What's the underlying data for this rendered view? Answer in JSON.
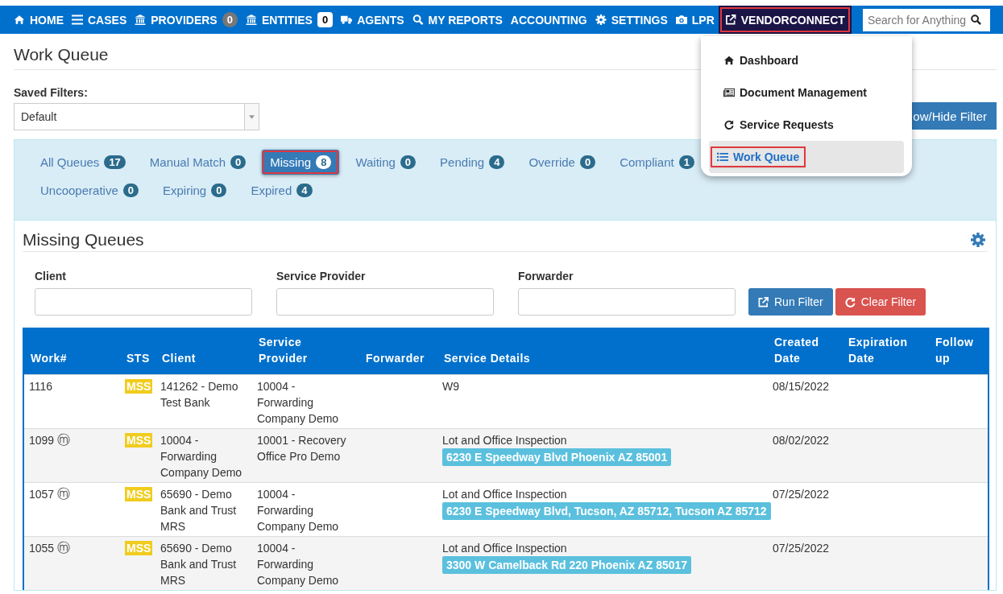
{
  "nav": {
    "items": [
      {
        "kind": "home",
        "label": "HOME"
      },
      {
        "kind": "cases",
        "label": "CASES"
      },
      {
        "kind": "providers",
        "label": "PROVIDERS",
        "count": "0"
      },
      {
        "kind": "entities",
        "label": "ENTITIES",
        "count": "0"
      },
      {
        "kind": "agents",
        "label": "AGENTS"
      },
      {
        "kind": "reports",
        "label": "MY REPORTS"
      },
      {
        "kind": "plain",
        "label": "ACCOUNTING"
      },
      {
        "kind": "settings",
        "label": "SETTINGS"
      },
      {
        "kind": "lpr",
        "label": "LPR"
      },
      {
        "kind": "vendor",
        "label": "VENDORCONNECT",
        "selected": true,
        "highlighted": true
      }
    ],
    "search": {
      "placeholder": "Search for Anything"
    }
  },
  "dropdown": [
    {
      "kind": "dashboard",
      "label": "Dashboard",
      "selected": false,
      "highlighted": false
    },
    {
      "kind": "documents",
      "label": "Document Management",
      "selected": false,
      "highlighted": false
    },
    {
      "kind": "requests",
      "label": "Service Requests",
      "selected": false,
      "highlighted": false
    },
    {
      "kind": "queue",
      "label": "Work Queue",
      "selected": true,
      "highlighted": true
    }
  ],
  "page_title": "Work Queue",
  "saved_filters": {
    "label": "Saved Filters:",
    "value": "Default"
  },
  "show_hide_button": "ow/Hide Filter",
  "tabs": [
    {
      "label": "All Queues",
      "count": "17",
      "selected": false,
      "highlighted": false
    },
    {
      "label": "Manual Match",
      "count": "0",
      "selected": false,
      "highlighted": false
    },
    {
      "label": "Missing",
      "count": "8",
      "selected": true,
      "highlighted": true
    },
    {
      "label": "Waiting",
      "count": "0",
      "selected": false,
      "highlighted": false
    },
    {
      "label": "Pending",
      "count": "4",
      "selected": false,
      "highlighted": false
    },
    {
      "label": "Override",
      "count": "0",
      "selected": false,
      "highlighted": false
    },
    {
      "label": "Compliant",
      "count": "1",
      "selected": false,
      "highlighted": false
    },
    {
      "label": "Uncooperative",
      "count": "0",
      "selected": false,
      "highlighted": false
    },
    {
      "label": "Expiring",
      "count": "0",
      "selected": false,
      "highlighted": false
    },
    {
      "label": "Expired",
      "count": "4",
      "selected": false,
      "highlighted": false
    }
  ],
  "section_title": "Missing Queues",
  "filters": [
    {
      "label": "Client"
    },
    {
      "label": "Service Provider"
    },
    {
      "label": "Forwarder"
    }
  ],
  "buttons": [
    {
      "kind": "run",
      "label": "Run Filter"
    },
    {
      "kind": "clear",
      "label": "Clear Filter"
    }
  ],
  "table": {
    "columns": [
      "Work#",
      "STS",
      "Client",
      "Service Provider",
      "Forwarder",
      "Service Details",
      "Created Date",
      "Expiration Date",
      "Follow up"
    ],
    "rows": [
      {
        "work": "1116",
        "mark": "",
        "status": "MSS",
        "client": "141262 - Demo Test Bank",
        "provider": "10004 - Forwarding Company Demo",
        "details": "W9",
        "address": "",
        "created": "08/15/2022"
      },
      {
        "work": "1099",
        "mark": "ⓜ",
        "status": "MSS",
        "client": "10004 - Forwarding Company Demo",
        "provider": "10001 - Recovery Office Pro Demo",
        "details": "Lot and Office Inspection",
        "address": "6230 E Speedway Blvd Phoenix AZ 85001",
        "created": "08/02/2022"
      },
      {
        "work": "1057",
        "mark": "ⓜ",
        "status": "MSS",
        "client": "65690 - Demo Bank and Trust MRS",
        "provider": "10004 - Forwarding Company Demo",
        "details": "Lot and Office Inspection",
        "address": "6230 E Speedway Blvd, Tucson, AZ 85712, Tucson AZ 85712",
        "created": "07/25/2022"
      },
      {
        "work": "1055",
        "mark": "ⓜ",
        "status": "MSS",
        "client": "65690 - Demo Bank and Trust MRS",
        "provider": "10004 - Forwarding Company Demo",
        "details": "Lot and Office Inspection",
        "address": "3300 W Camelback Rd 220 Phoenix AZ 85017",
        "created": "07/25/2022"
      }
    ]
  }
}
